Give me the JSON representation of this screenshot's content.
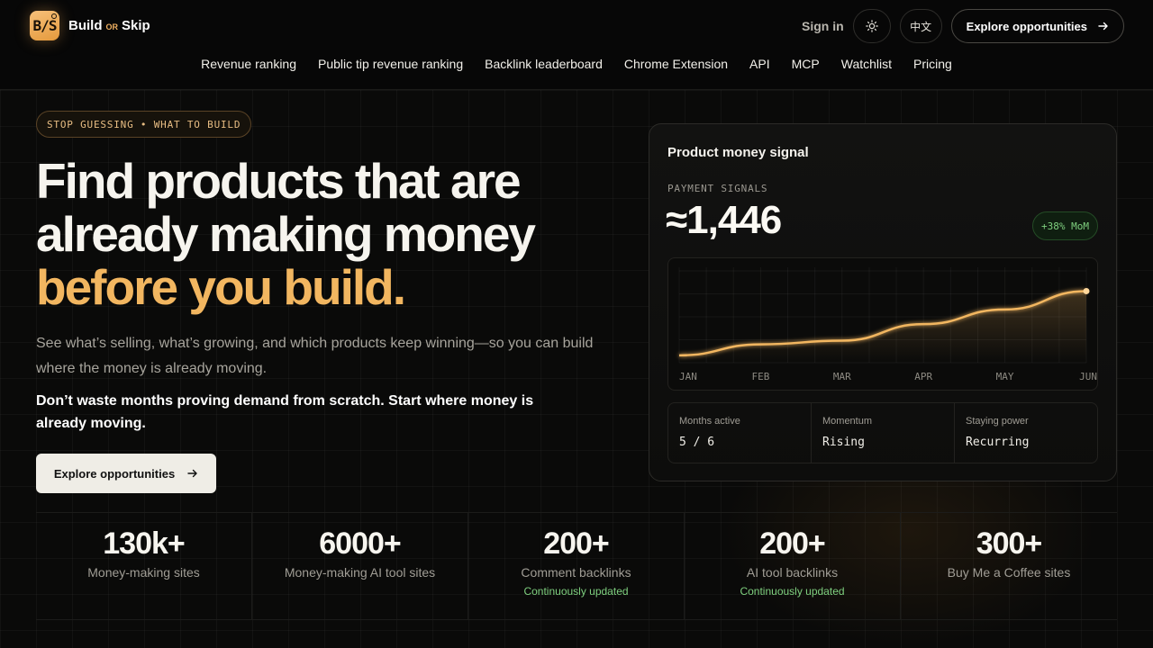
{
  "header": {
    "brand_part1": "Build",
    "brand_or": "OR",
    "brand_part2": "Skip",
    "logo_letters": "B/S",
    "sign_in": "Sign in",
    "theme_icon": "sun-icon",
    "lang": "中文",
    "cta": "Explore opportunities"
  },
  "nav": [
    "Revenue ranking",
    "Public tip revenue ranking",
    "Backlink leaderboard",
    "Chrome Extension",
    "API",
    "MCP",
    "Watchlist",
    "Pricing"
  ],
  "hero": {
    "badge": "STOP GUESSING • WHAT TO BUILD",
    "title_line1": "Find products that are",
    "title_line2": "already making money",
    "title_accent": "before you build.",
    "subtitle": "See what’s selling, what’s growing, and which products keep winning—so you can build where the money is already moving.",
    "subtitle_bold": "Don’t waste months proving demand from scratch. Start where money is already moving.",
    "cta": "Explore opportunities"
  },
  "card": {
    "title": "Product money signal",
    "label": "PAYMENT SIGNALS",
    "value": "≈1,446",
    "change": "+38% MoM",
    "stats": [
      {
        "label": "Months active",
        "value": "5 / 6"
      },
      {
        "label": "Momentum",
        "value": "Rising"
      },
      {
        "label": "Staying power",
        "value": "Recurring"
      }
    ]
  },
  "chart_data": {
    "type": "area",
    "x": [
      "JAN",
      "FEB",
      "MAR",
      "APR",
      "MAY",
      "JUN"
    ],
    "series": [
      {
        "values": [
          8,
          20,
          24,
          42,
          58,
          78
        ]
      }
    ],
    "ylim": [
      0,
      100
    ],
    "grid": true,
    "color": "#f2b660"
  },
  "metrics": [
    {
      "num": "130k+",
      "label": "Money-making sites",
      "note": ""
    },
    {
      "num": "6000+",
      "label": "Money-making AI tool sites",
      "note": ""
    },
    {
      "num": "200+",
      "label": "Comment backlinks",
      "note": "Continuously updated"
    },
    {
      "num": "200+",
      "label": "AI tool backlinks",
      "note": "Continuously updated"
    },
    {
      "num": "300+",
      "label": "Buy Me a Coffee sites",
      "note": ""
    }
  ],
  "colors": {
    "accent": "#f2b660",
    "positive": "#7fd07f",
    "background": "#0a0a09"
  }
}
